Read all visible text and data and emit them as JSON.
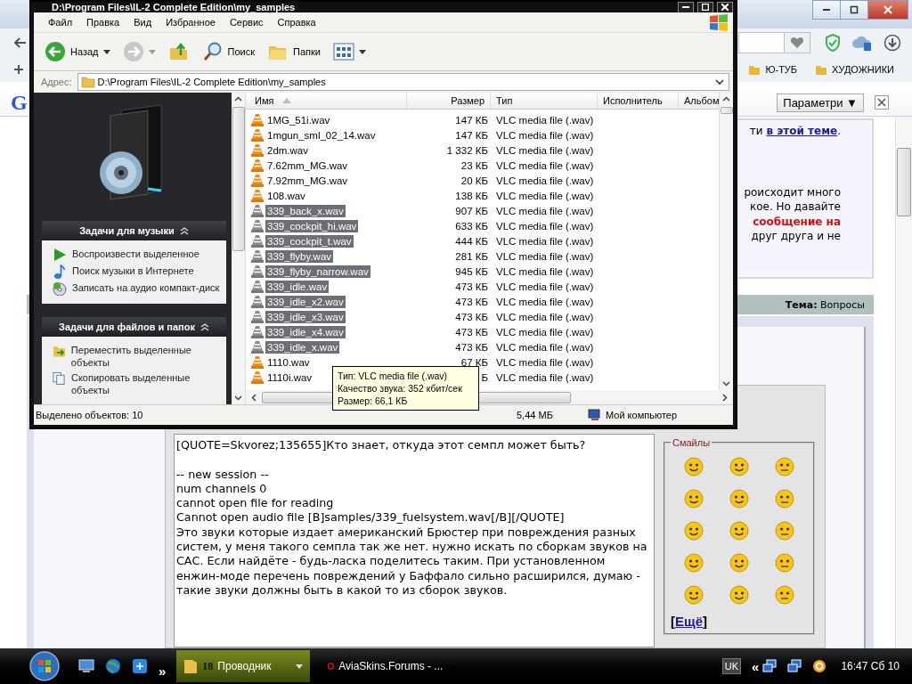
{
  "browser": {
    "bookmarks": [
      {
        "label": "Ю-ТУБ"
      },
      {
        "label": "ХУДОЖНИКИ"
      }
    ],
    "search_toolbar": {
      "logo": "G",
      "options_button": "Параметри ▼"
    },
    "post": {
      "link_line": {
        "before": "ти ",
        "link": "в этой теме",
        "after": "."
      },
      "lines": [
        {
          "text": "роисходит много",
          "kind": "plain"
        },
        {
          "text": "кое. Но давайте",
          "kind": "plain"
        },
        {
          "text": "сообщение на",
          "kind": "alert"
        },
        {
          "text": "друг друга и не",
          "kind": "plain"
        }
      ]
    },
    "topic_bar": "**Тема:** Вопросы",
    "reply": {
      "message": "[QUOTE=Skvorez;135655]Кто знает, откуда этот семпл может быть?\n\n-- new session --\nnum channels 0\ncannot open file for reading\nCannot open audio file [B]samples/339_fuelsystem.wav[/B][/QUOTE]\nЭто звуки которые издает американский Брюстер при повреждения разных систем, у меня такого семпла так же нет. нужно искать по сборкам звуков на САС. Если найдёте - будь-ласка поделитесь таким. При установленном енжин-моде перечень повреждений у Баффало сильно расширился, думаю - такие звуки должны быть в какой то из сборок звуков.",
      "smilies": {
        "legend": "Смайлы",
        "more": {
          "before": "[",
          "link": "Ещё",
          "after": "]"
        }
      }
    }
  },
  "explorer": {
    "title": "D:\\Program Files\\IL-2 Complete Edition\\my_samples",
    "menu": [
      "Файл",
      "Правка",
      "Вид",
      "Избранное",
      "Сервис",
      "Справка"
    ],
    "toolbar": [
      {
        "kind": "back",
        "label": "Назад"
      },
      {
        "kind": "forward"
      },
      {
        "kind": "up"
      },
      {
        "kind": "search",
        "label": "Поиск"
      },
      {
        "kind": "folders",
        "label": "Папки"
      },
      {
        "kind": "views"
      }
    ],
    "address": {
      "label": "Адрес:",
      "value": "D:\\Program Files\\IL-2 Complete Edition\\my_samples"
    },
    "task_panes": [
      {
        "title": "Задачи для музыки",
        "items": [
          {
            "kind": "play",
            "label": "Воспроизвести выделенное"
          },
          {
            "kind": "note",
            "label": "Поиск музыки в Интернете"
          },
          {
            "kind": "burn",
            "label": "Записать на аудио компакт-диск"
          }
        ]
      },
      {
        "title": "Задачи для файлов и папок",
        "items": [
          {
            "kind": "move",
            "label": "Переместить выделенные объекты"
          },
          {
            "kind": "copy",
            "label": "Скопировать выделенные объекты"
          }
        ]
      }
    ],
    "columns": [
      {
        "label": "Имя",
        "sorted": true
      },
      {
        "label": "Размер",
        "sorted": false
      },
      {
        "label": "Тип",
        "sorted": false
      },
      {
        "label": "Исполнитель",
        "sorted": false
      },
      {
        "label": "Альбом",
        "sorted": false
      }
    ],
    "rows": [
      {
        "name": "1MG_51i.wav",
        "size": "147 КБ",
        "type": "VLC media file (.wav)",
        "selected": false
      },
      {
        "name": "1mgun_sml_02_14.wav",
        "size": "147 КБ",
        "type": "VLC media file (.wav)",
        "selected": false
      },
      {
        "name": "2dm.wav",
        "size": "1 332 КБ",
        "type": "VLC media file (.wav)",
        "selected": false
      },
      {
        "name": "7.62mm_MG.wav",
        "size": "23 КБ",
        "type": "VLC media file (.wav)",
        "selected": false
      },
      {
        "name": "7.92mm_MG.wav",
        "size": "20 КБ",
        "type": "VLC media file (.wav)",
        "selected": false
      },
      {
        "name": "108.wav",
        "size": "138 КБ",
        "type": "VLC media file (.wav)",
        "selected": false
      },
      {
        "name": "339_back_x.wav",
        "size": "907 КБ",
        "type": "VLC media file (.wav)",
        "selected": true
      },
      {
        "name": "339_cockpit_hi.wav",
        "size": "633 КБ",
        "type": "VLC media file (.wav)",
        "selected": true
      },
      {
        "name": "339_cockpit_t.wav",
        "size": "444 КБ",
        "type": "VLC media file (.wav)",
        "selected": true
      },
      {
        "name": "339_flyby.wav",
        "size": "281 КБ",
        "type": "VLC media file (.wav)",
        "selected": true
      },
      {
        "name": "339_flyby_narrow.wav",
        "size": "945 КБ",
        "type": "VLC media file (.wav)",
        "selected": true
      },
      {
        "name": "339_idle.wav",
        "size": "473 КБ",
        "type": "VLC media file (.wav)",
        "selected": true
      },
      {
        "name": "339_idle_x2.wav",
        "size": "473 КБ",
        "type": "VLC media file (.wav)",
        "selected": true
      },
      {
        "name": "339_idle_x3.wav",
        "size": "473 КБ",
        "type": "VLC media file (.wav)",
        "selected": true
      },
      {
        "name": "339_idle_x4.wav",
        "size": "473 КБ",
        "type": "VLC media file (.wav)",
        "selected": true
      },
      {
        "name": "339_idle_x.wav",
        "size": "473 КБ",
        "type": "VLC media file (.wav)",
        "selected": true
      },
      {
        "name": "1110.wav",
        "size": "67 КБ",
        "type": "VLC media file (.wav)",
        "selected": false
      },
      {
        "name": "1110i.wav",
        "size": "Б",
        "type": "VLC media file (.wav)",
        "selected": false
      }
    ],
    "status": {
      "selection": "Выделено объектов: 10",
      "size": "5,44 МБ",
      "location": "Мой компьютер"
    }
  },
  "tooltip": {
    "lines": [
      "Тип: VLC media file (.wav)",
      "Качество звука: 352 кбит/сек",
      "Размер: 66,1 КБ"
    ]
  },
  "taskbar": {
    "more": "»",
    "tasks": [
      {
        "count": "18",
        "label": "Проводник",
        "selected": true
      },
      {
        "label": "AviaSkins.Forums - ...",
        "selected": false
      }
    ],
    "tray": {
      "language": "UK",
      "expand": "«",
      "clock": "16:47 Сб 10"
    }
  }
}
